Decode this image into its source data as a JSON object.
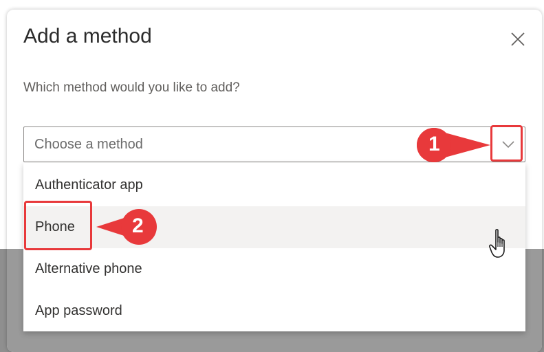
{
  "dialog": {
    "title": "Add a method",
    "subtitle": "Which method would you like to add?",
    "close_icon": "close-icon"
  },
  "select": {
    "placeholder": "Choose a method",
    "chevron_icon": "chevron-down-icon"
  },
  "options": [
    {
      "label": "Authenticator app"
    },
    {
      "label": "Phone"
    },
    {
      "label": "Alternative phone"
    },
    {
      "label": "App password"
    }
  ],
  "annotations": {
    "step1": "1",
    "step2": "2"
  },
  "colors": {
    "callout_red": "#e8393b",
    "hover_bg": "#f3f2f1",
    "overlay_gray": "#9a9a9a"
  }
}
